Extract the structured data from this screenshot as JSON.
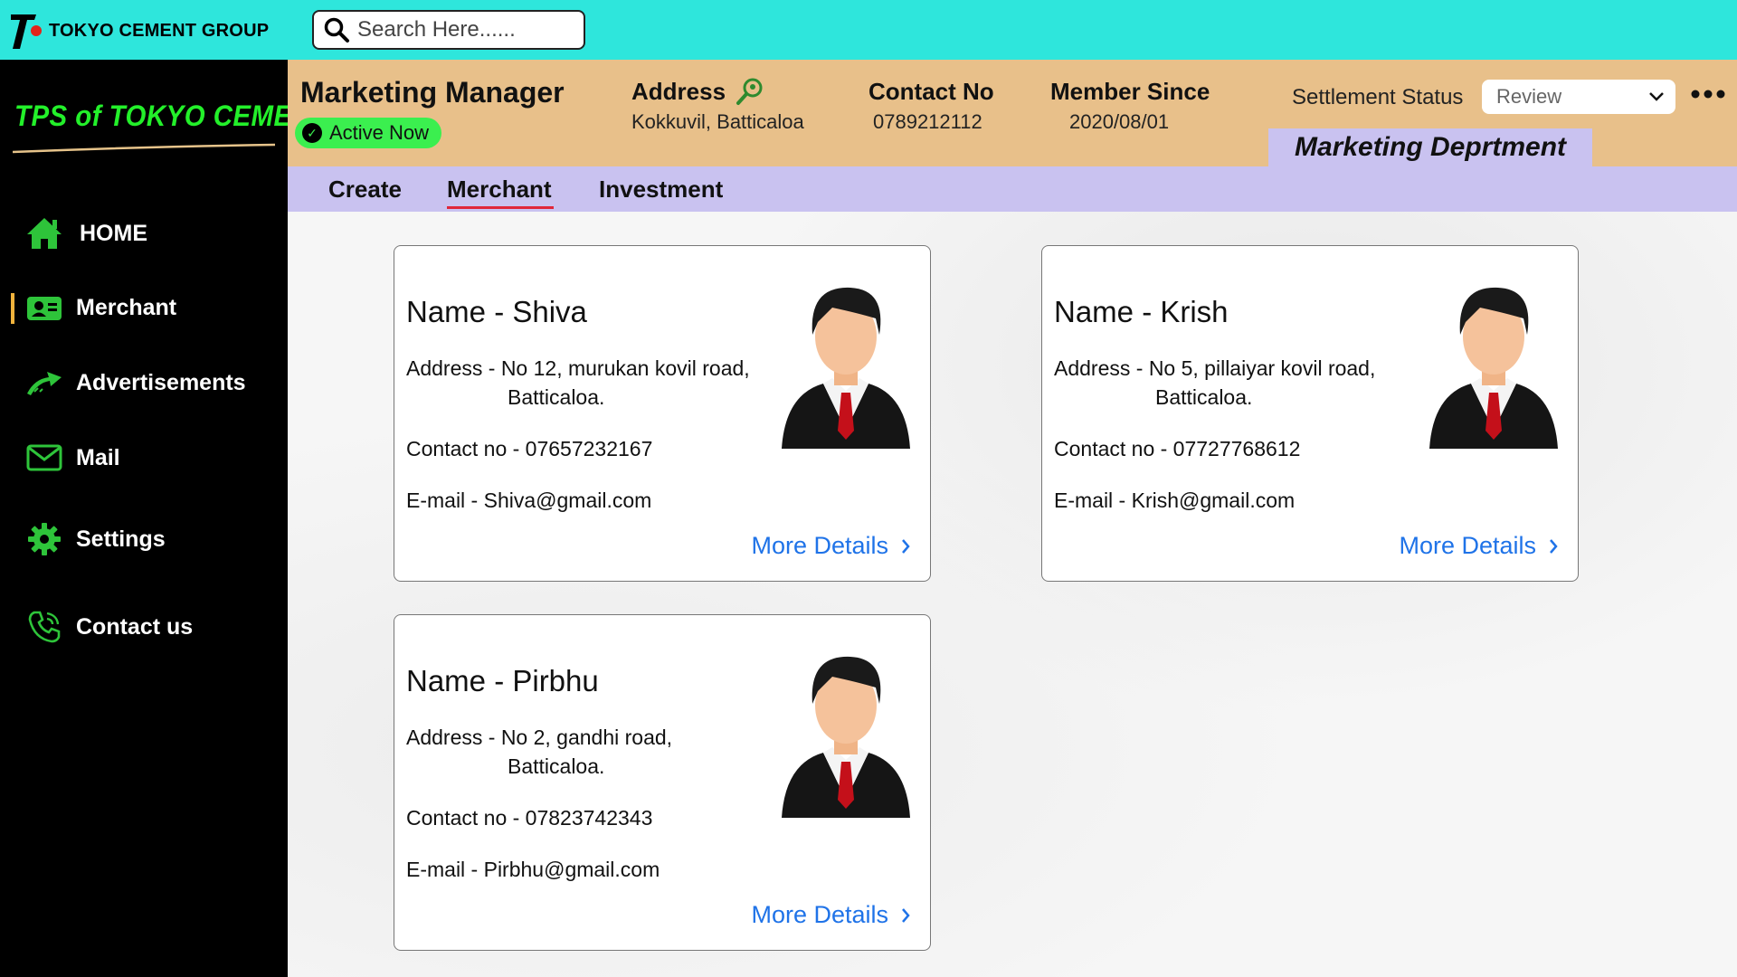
{
  "topbar": {
    "brand_name": "TOKYO CEMENT GROUP",
    "search_placeholder": "Search Here......"
  },
  "sidebar": {
    "logo_text": "TPS of TOKYO CEMENT",
    "items": [
      {
        "label": "HOME",
        "icon": "home-icon"
      },
      {
        "label": "Merchant",
        "icon": "merchant-icon"
      },
      {
        "label": "Advertisements",
        "icon": "advertisement-icon"
      },
      {
        "label": "Mail",
        "icon": "mail-icon"
      },
      {
        "label": "Settings",
        "icon": "gear-icon"
      },
      {
        "label": "Contact us",
        "icon": "phone-icon"
      }
    ],
    "active": "Merchant"
  },
  "header": {
    "title": "Marketing Manager",
    "status": "Active Now",
    "address_label": "Address",
    "address_value": "Kokkuvil, Batticaloa",
    "contact_label": "Contact No",
    "contact_value": "0789212112",
    "member_label": "Member Since",
    "member_value": "2020/08/01",
    "settlement_label": "Settlement Status",
    "settlement_value": "Review",
    "department": "Marketing Deprtment"
  },
  "tabs": [
    {
      "label": "Create"
    },
    {
      "label": "Merchant",
      "active": true
    },
    {
      "label": "Investment"
    }
  ],
  "merchants": [
    {
      "name": "Name - Shiva",
      "address_line1": "Address - No 12, murukan kovil road,",
      "address_line2": "Batticaloa.",
      "contact": "Contact no - 07657232167",
      "email": "E-mail - Shiva@gmail.com",
      "more": "More Details"
    },
    {
      "name": "Name - Krish",
      "address_line1": "Address - No 5, pillaiyar kovil road,",
      "address_line2": "Batticaloa.",
      "contact": "Contact no - 07727768612",
      "email": "E-mail - Krish@gmail.com",
      "more": "More Details"
    },
    {
      "name": "Name - Pirbhu",
      "address_line1": "Address - No 2, gandhi road,",
      "address_line2": "Batticaloa.",
      "contact": "Contact no - 07823742343",
      "email": "E-mail - Pirbhu@gmail.com",
      "more": "More Details"
    }
  ],
  "colors": {
    "topbar": "#2ee6dc",
    "header": "#e8c08a",
    "tabs": "#c9c2f0",
    "sidebar": "#000000",
    "accent_green": "#23f02a",
    "link_blue": "#1f73e8",
    "active_underline": "#e0263a"
  }
}
